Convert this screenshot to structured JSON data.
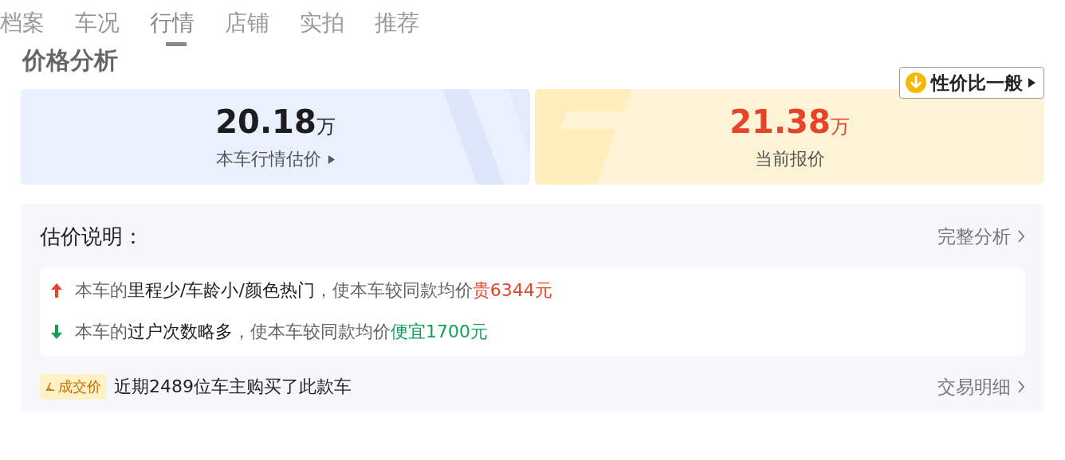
{
  "tabs": [
    {
      "label": "档案",
      "selected": false
    },
    {
      "label": "车况",
      "selected": false
    },
    {
      "label": "行情",
      "selected": true
    },
    {
      "label": "店铺",
      "selected": false
    },
    {
      "label": "实拍",
      "selected": false
    },
    {
      "label": "推荐",
      "selected": false
    }
  ],
  "heading": "价格分析",
  "value_badge": {
    "label": "性价比一般"
  },
  "prices": [
    {
      "kind": "estimate",
      "amount": "20.18",
      "unit": "万",
      "label": "本车行情估价",
      "has_arrow": true
    },
    {
      "kind": "quote",
      "amount": "21.38",
      "unit": "万",
      "label": "当前报价",
      "has_arrow": false
    }
  ],
  "explanation": {
    "title": "估价说明：",
    "link": "完整分析",
    "factors": [
      {
        "kind": "increase",
        "prefix": "本车的",
        "factor": "里程少/车龄小/颜色热门",
        "middle": "，使本车较同款均价",
        "result": "贵6344元"
      },
      {
        "kind": "decrease",
        "prefix": "本车的",
        "factor": "过户次数略多",
        "middle": "，使本车较同款均价",
        "result": "便宜1700元"
      }
    ],
    "deal_tag": "成交价",
    "deal_text": "近期2489位车主购买了此款车",
    "deal_link": "交易明细"
  }
}
